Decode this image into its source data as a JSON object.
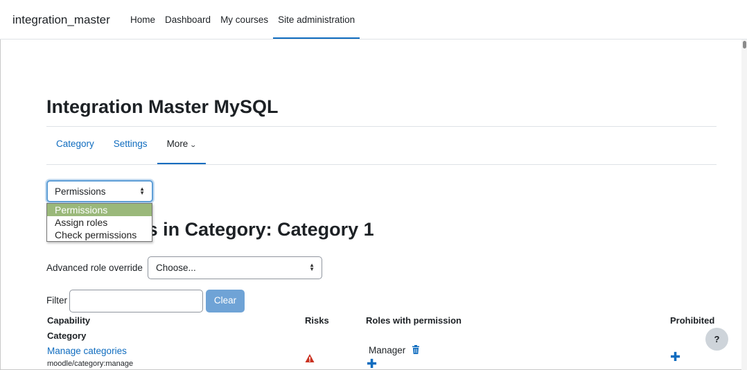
{
  "navbar": {
    "brand": "integration_master",
    "links": [
      {
        "label": "Home"
      },
      {
        "label": "Dashboard"
      },
      {
        "label": "My courses"
      },
      {
        "label": "Site administration"
      }
    ]
  },
  "page": {
    "title": "Integration Master MySQL",
    "heading": "Permissions in Category: Category 1",
    "heading_visible_part": "s in Category: Category 1"
  },
  "secondary_nav": {
    "items": [
      {
        "label": "Category"
      },
      {
        "label": "Settings"
      },
      {
        "label": "More"
      }
    ]
  },
  "jump_select": {
    "value": "Permissions",
    "options": [
      "Permissions",
      "Assign roles",
      "Check permissions"
    ]
  },
  "advanced_override": {
    "label": "Advanced role override",
    "value": "Choose..."
  },
  "filter": {
    "label": "Filter",
    "value": "",
    "clear_label": "Clear"
  },
  "table": {
    "headers": {
      "capability": "Capability",
      "risks": "Risks",
      "roles": "Roles with permission",
      "prohibited": "Prohibited"
    },
    "group": "Category",
    "rows": [
      {
        "name": "Manage categories",
        "code": "moodle/category:manage",
        "risk_icon": "warning-icon",
        "roles": [
          "Manager"
        ]
      }
    ]
  },
  "help": {
    "label": "?"
  },
  "colors": {
    "accent": "#0f6cbf",
    "selected_option": "#9ab87a",
    "risk": "#ca3120",
    "clear_button": "#6fa3d6"
  }
}
